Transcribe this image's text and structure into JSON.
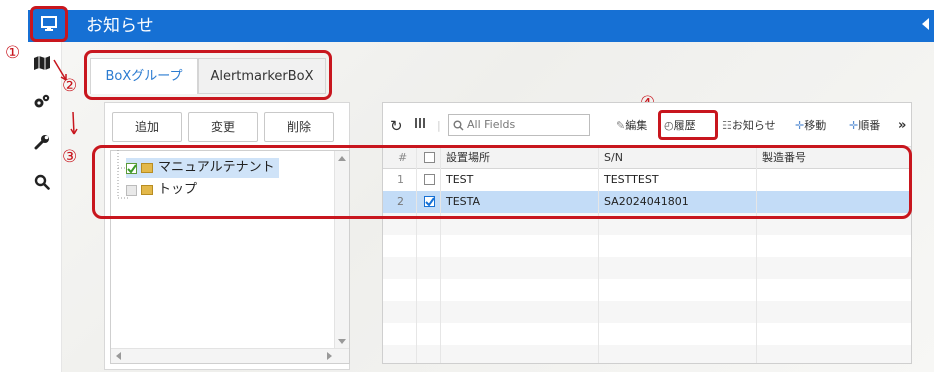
{
  "header": {
    "title": "お知らせ"
  },
  "tabs": [
    {
      "label": "BoXグループ"
    },
    {
      "label": "AlertmarkerBoX"
    }
  ],
  "tree_buttons": {
    "add": "追加",
    "edit": "変更",
    "delete": "削除"
  },
  "tree": [
    {
      "label": "マニュアルテナント",
      "checked": true
    },
    {
      "label": "トップ",
      "checked": false
    }
  ],
  "toolbar": {
    "search_placeholder": "All Fields",
    "edit": "編集",
    "history": "履歴",
    "notice": "お知らせ",
    "move": "移動",
    "order": "順番",
    "more": "»"
  },
  "grid": {
    "columns": [
      "#",
      "設置場所",
      "S/N",
      "製造番号"
    ],
    "rows": [
      {
        "num": "1",
        "location": "TEST",
        "sn": "TESTTEST",
        "serial": "",
        "checked": false
      },
      {
        "num": "2",
        "location": "TESTA",
        "sn": "SA2024041801",
        "serial": "",
        "checked": true
      }
    ]
  },
  "callouts": [
    "①",
    "②",
    "③",
    "④"
  ],
  "colors": {
    "accent": "#1670d4",
    "callout": "#c8161e",
    "selected_row": "#c3dcf7"
  }
}
